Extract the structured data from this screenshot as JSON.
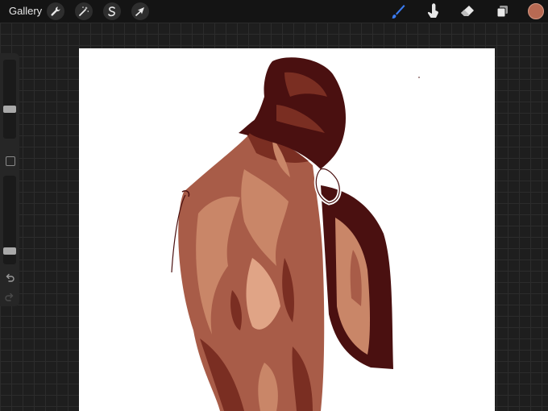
{
  "topbar": {
    "gallery_label": "Gallery",
    "tools_left": [
      "wrench-icon",
      "magic-wand-icon",
      "selection-icon",
      "transform-arrow-icon"
    ],
    "tools_right": [
      "brush-icon",
      "smudge-icon",
      "eraser-icon",
      "layers-icon"
    ],
    "current_color": "#b86a53",
    "active_tool_color": "#3a7bf0"
  },
  "sidebar": {
    "brush_size_level": 0.35,
    "opacity_level": 0.1
  },
  "canvas": {
    "artwork": "illustration-back-of-woman",
    "palette": [
      "#4a1010",
      "#7a2e22",
      "#a85c48",
      "#c98668",
      "#e0a486"
    ]
  }
}
